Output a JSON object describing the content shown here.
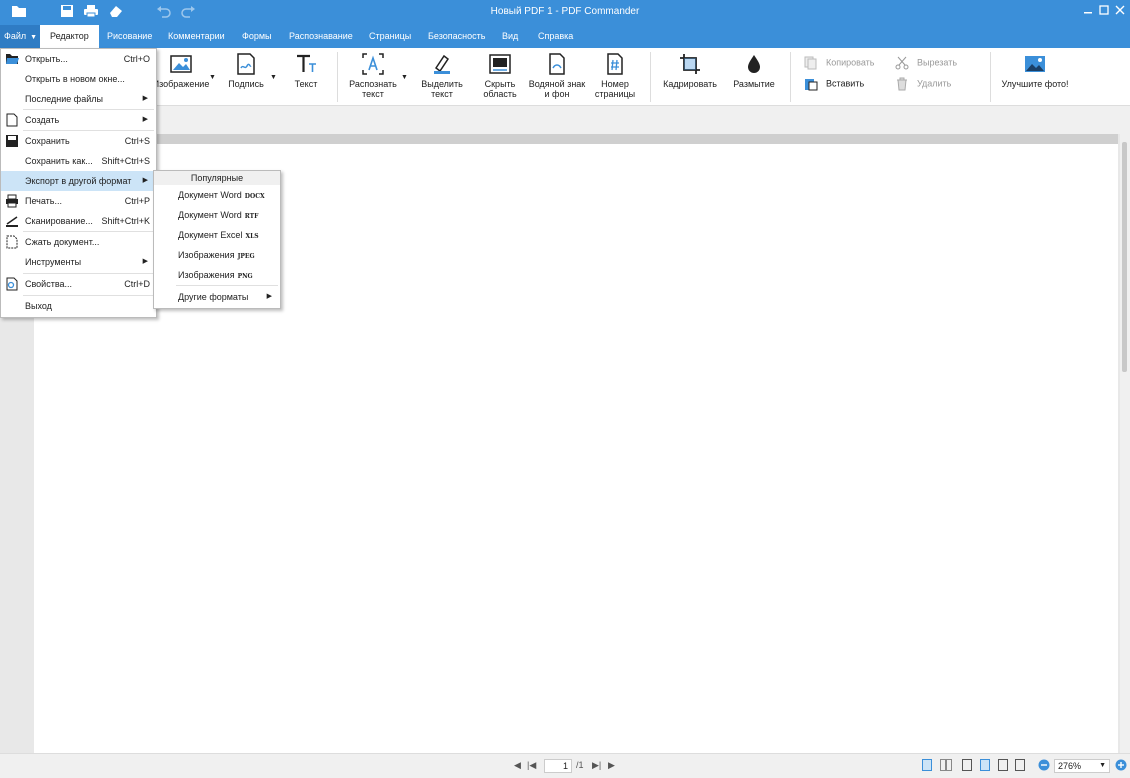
{
  "window": {
    "title": "Новый PDF 1 - PDF Commander"
  },
  "tabs": {
    "file": "Файл",
    "editor": "Редактор",
    "drawing": "Рисование",
    "comments": "Комментарии",
    "forms": "Формы",
    "recognition": "Распознавание",
    "pages": "Страницы",
    "security": "Безопасность",
    "view": "Вид",
    "help": "Справка"
  },
  "ribbon": {
    "image": "Изображение",
    "signature": "Подпись",
    "text": "Текст",
    "recognize_text_1": "Распознать",
    "recognize_text_2": "текст",
    "select_text_1": "Выделить",
    "select_text_2": "текст",
    "hide_area_1": "Скрыть",
    "hide_area_2": "область",
    "watermark_1": "Водяной знак",
    "watermark_2": "и фон",
    "page_number_1": "Номер",
    "page_number_2": "страницы",
    "crop": "Кадрировать",
    "blur": "Размытие",
    "copy": "Копировать",
    "paste": "Вставить",
    "cut": "Вырезать",
    "delete": "Удалить",
    "enhance_photo": "Улучшите фото!"
  },
  "file_menu": {
    "open": "Открыть...",
    "open_sc": "Ctrl+O",
    "open_new_window": "Открыть в новом окне...",
    "recent_files": "Последние файлы",
    "create": "Создать",
    "save": "Сохранить",
    "save_sc": "Ctrl+S",
    "save_as": "Сохранить как...",
    "save_as_sc": "Shift+Ctrl+S",
    "export": "Экспорт в другой формат",
    "print": "Печать...",
    "print_sc": "Ctrl+P",
    "scan": "Сканирование...",
    "scan_sc": "Shift+Ctrl+K",
    "compress": "Сжать документ...",
    "tools": "Инструменты",
    "properties": "Свойства...",
    "properties_sc": "Ctrl+D",
    "exit": "Выход"
  },
  "export_submenu": {
    "header": "Популярные",
    "word_docx": "Документ Word",
    "word_docx_fmt": "DOCX",
    "word_rtf": "Документ Word",
    "word_rtf_fmt": "RTF",
    "excel_xls": "Документ Excel",
    "excel_xls_fmt": "XLS",
    "images_jpeg": "Изображения",
    "images_jpeg_fmt": "JPEG",
    "images_png": "Изображения",
    "images_png_fmt": "PNG",
    "other_formats": "Другие форматы"
  },
  "statusbar": {
    "current_page": "1",
    "total_pages": "/1",
    "zoom": "276%"
  },
  "colors": {
    "accent": "#3b8fd9",
    "menu_highlight": "#cce4f7"
  }
}
